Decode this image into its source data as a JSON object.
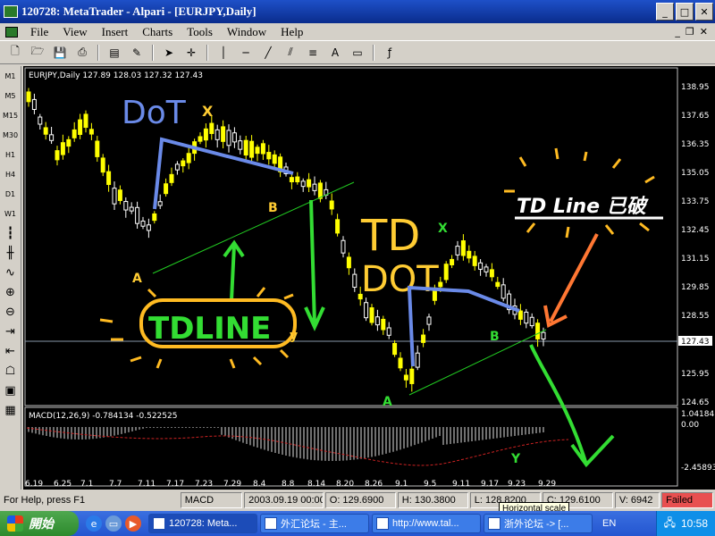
{
  "window": {
    "title": "120728: MetaTrader - Alpari - [EURJPY,Daily]"
  },
  "menu": {
    "items": [
      "File",
      "View",
      "Insert",
      "Charts",
      "Tools",
      "Window",
      "Help"
    ]
  },
  "timeframes": [
    "M1",
    "M5",
    "M15",
    "M30",
    "H1",
    "H4",
    "D1",
    "W1"
  ],
  "chart": {
    "header": "EURJPY,Daily  127.89 128.03 127.32 127.43",
    "price_ticks": [
      "138.95",
      "137.65",
      "136.35",
      "135.05",
      "133.75",
      "132.45",
      "131.15",
      "129.85",
      "128.55",
      "127.43",
      "125.95",
      "124.65"
    ],
    "current_price": "127.43",
    "date_ticks": [
      "6.19",
      "6.25",
      "7.1",
      "7.7",
      "7.11",
      "7.17",
      "7.23",
      "7.29",
      "8.4",
      "8.8",
      "8.14",
      "8.20",
      "8.26",
      "9.1",
      "9.5",
      "9.11",
      "9.17",
      "9.23",
      "9.29"
    ],
    "macd_header": "MACD(12,26,9)  -0.784134  -0.522525",
    "macd_ticks": [
      "1.04184",
      "0.00",
      "-2.45893"
    ],
    "annotations": {
      "dot1": "DoT",
      "x1": "X",
      "b1": "B",
      "a1": "A",
      "tdline": "TDLINE",
      "y1": "y",
      "td": "TD",
      "dot2": "DOT",
      "x2": "X",
      "b2": "B",
      "a2": "A",
      "y2": "Y",
      "broken": "TD Line 已破"
    }
  },
  "status": {
    "help": "For Help, press F1",
    "indicator": "MACD",
    "datetime": "2003.09.19 00:00",
    "open": "O: 129.6900",
    "high": "H: 130.3800",
    "low": "L: 128.8200",
    "close": "C: 129.6100",
    "volume": "V: 6942",
    "connection": "Failed"
  },
  "tooltip": "Horizontal scale",
  "taskbar": {
    "start": "開始",
    "tasks": [
      "120728: Meta...",
      "外汇论坛 - 主...",
      "http://www.tal...",
      "浙外论坛 -> [..."
    ],
    "lang": "EN",
    "clock": "10:58"
  },
  "colors": {
    "bull": "#ffffff",
    "bear": "#ffff00",
    "trendline": "#00ff00",
    "annotation_blue": "#6a8ae8",
    "annotation_yellow": "#ffcc33",
    "annotation_green": "#33ff33",
    "annotation_orange": "#ff7733"
  }
}
